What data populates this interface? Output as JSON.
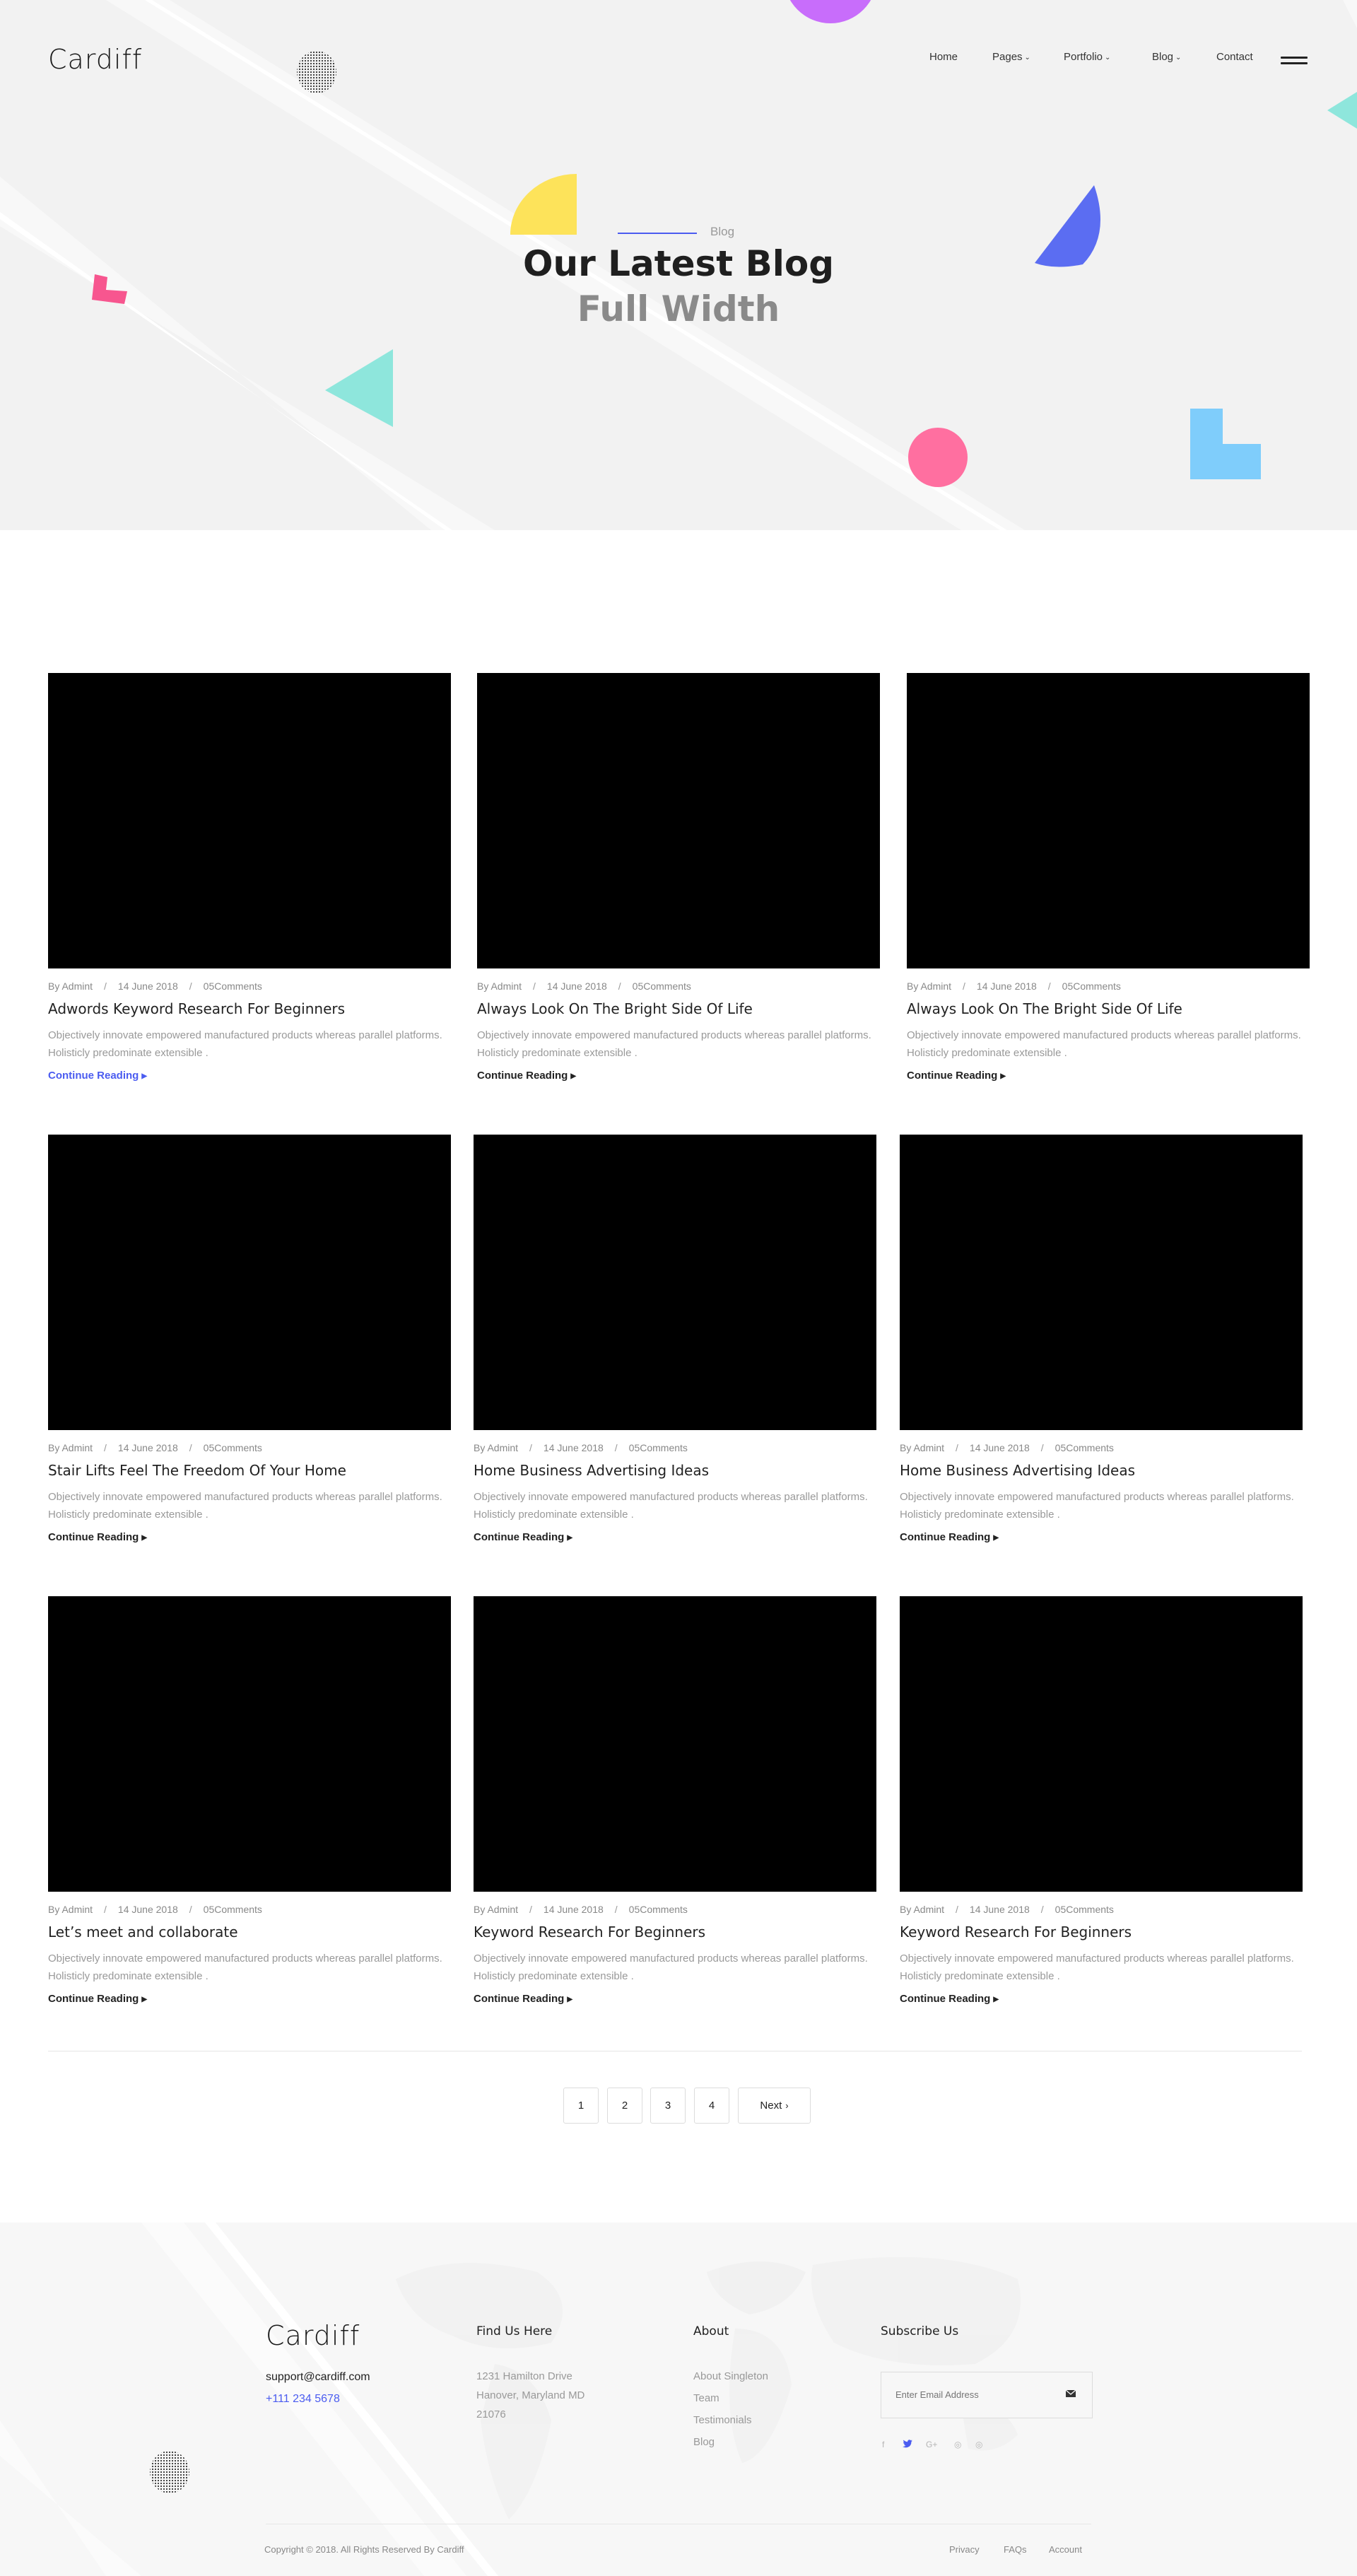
{
  "brand": {
    "logo": "Cardiff"
  },
  "nav": {
    "home": "Home",
    "pages": "Pages",
    "portfolio": "Portfolio",
    "blog": "Blog",
    "contact": "Contact"
  },
  "hero": {
    "crumb": "Blog",
    "title": "Our Latest Blog",
    "subtitle": "Full Width"
  },
  "posts": [
    {
      "author": "By Admint",
      "date": "14 June 2018",
      "comments": "05Comments",
      "title": "Adwords Keyword Research For Beginners",
      "excerpt": "Objectively innovate empowered manufactured products whereas parallel platforms. Holisticly predominate extensible .",
      "more": "Continue Reading"
    },
    {
      "author": "By Admint",
      "date": "14 June 2018",
      "comments": "05Comments",
      "title": "Always Look On The Bright Side Of Life",
      "excerpt": "Objectively innovate empowered manufactured products whereas parallel platforms. Holisticly predominate extensible .",
      "more": "Continue Reading"
    },
    {
      "author": "By Admint",
      "date": "14 June 2018",
      "comments": "05Comments",
      "title": "Always Look On The Bright Side Of Life",
      "excerpt": "Objectively innovate empowered manufactured products whereas parallel platforms. Holisticly predominate extensible .",
      "more": "Continue Reading"
    },
    {
      "author": "By Admint",
      "date": "14 June 2018",
      "comments": "05Comments",
      "title": "Stair Lifts Feel The Freedom Of Your Home",
      "excerpt": "Objectively innovate empowered manufactured products whereas parallel platforms. Holisticly predominate extensible .",
      "more": "Continue Reading"
    },
    {
      "author": "By Admint",
      "date": "14 June 2018",
      "comments": "05Comments",
      "title": "Home Business Advertising Ideas",
      "excerpt": "Objectively innovate empowered manufactured products whereas parallel platforms. Holisticly predominate extensible .",
      "more": "Continue Reading"
    },
    {
      "author": "By Admint",
      "date": "14 June 2018",
      "comments": "05Comments",
      "title": "Home Business Advertising Ideas",
      "excerpt": "Objectively innovate empowered manufactured products whereas parallel platforms. Holisticly predominate extensible .",
      "more": "Continue Reading"
    },
    {
      "author": "By Admint",
      "date": "14 June 2018",
      "comments": "05Comments",
      "title": "Let’s meet and collaborate",
      "excerpt": "Objectively innovate empowered manufactured products whereas parallel platforms. Holisticly predominate extensible .",
      "more": "Continue Reading"
    },
    {
      "author": "By Admint",
      "date": "14 June 2018",
      "comments": "05Comments",
      "title": "Keyword Research For Beginners",
      "excerpt": "Objectively innovate empowered manufactured products whereas parallel platforms. Holisticly predominate extensible .",
      "more": "Continue Reading"
    },
    {
      "author": "By Admint",
      "date": "14 June 2018",
      "comments": "05Comments",
      "title": "Keyword Research For Beginners",
      "excerpt": "Objectively innovate empowered manufactured products whereas parallel platforms. Holisticly predominate extensible .",
      "more": "Continue Reading"
    }
  ],
  "pagination": {
    "p1": "1",
    "p2": "2",
    "p3": "3",
    "p4": "4",
    "next": "Next"
  },
  "footer": {
    "email": "support@cardiff.com",
    "phone": "+111 234 5678",
    "find_heading": "Find Us Here",
    "address": [
      "1231 Hamilton Drive",
      "Hanover, Maryland MD",
      "21076"
    ],
    "about_heading": "About",
    "about_links": [
      "About Singleton",
      "Team",
      "Testimonials",
      "Blog"
    ],
    "subscribe_heading": "Subscribe Us",
    "subscribe_placeholder": "Enter Email Address",
    "social_icons": [
      "facebook-icon",
      "twitter-icon",
      "google-plus-icon",
      "dribbble-icon",
      "instagram-icon"
    ],
    "copyright": "Copyright © 2018. All Rights Reserved By Cardiff",
    "bottom_links": [
      "Privacy",
      "FAQs",
      "Account"
    ]
  },
  "colors": {
    "accent": "#4b5cf0",
    "hero_bg": "#f2f2f2",
    "footer_bg": "#f7f7f7",
    "shape_yellow": "#fde35a",
    "shape_pink": "#f7568f",
    "shape_teal": "#8ee6dc",
    "shape_blue": "#5b6df2",
    "shape_sky": "#7fcdfb",
    "shape_rose": "#ff6fa0",
    "shape_purple": "#c86dfb"
  }
}
